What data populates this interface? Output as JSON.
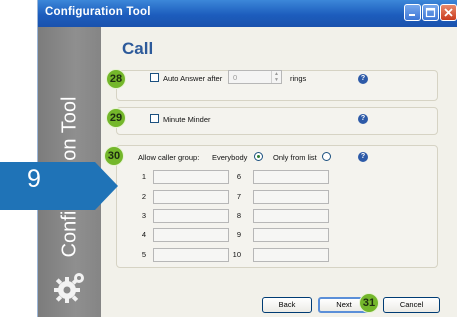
{
  "window": {
    "title": "Configuration Tool"
  },
  "sidebar": {
    "title": "Configuration Tool",
    "icon": "gear-icon"
  },
  "page": {
    "title": "Call"
  },
  "auto_answer": {
    "checkbox_label": "Auto Answer after",
    "checked": false,
    "rings_value": "0",
    "rings_suffix": "rings"
  },
  "minute_minder": {
    "checkbox_label": "Minute Minder",
    "checked": false
  },
  "caller_group": {
    "label": "Allow caller group:",
    "options": [
      {
        "label": "Everybody",
        "selected": true
      },
      {
        "label": "Only from list",
        "selected": false
      }
    ],
    "slots": [
      "1",
      "2",
      "3",
      "4",
      "5",
      "6",
      "7",
      "8",
      "9",
      "10"
    ]
  },
  "buttons": {
    "back": "Back",
    "next": "Next",
    "cancel": "Cancel"
  },
  "callouts": {
    "auto_answer": "28",
    "minute_minder": "29",
    "caller_group": "30",
    "next": "31",
    "step": "9"
  },
  "colors": {
    "titlebar": "#1d5dbd",
    "accent": "#2d5a9a",
    "callout": "#74b72b",
    "step_arrow": "#1f73b7"
  }
}
